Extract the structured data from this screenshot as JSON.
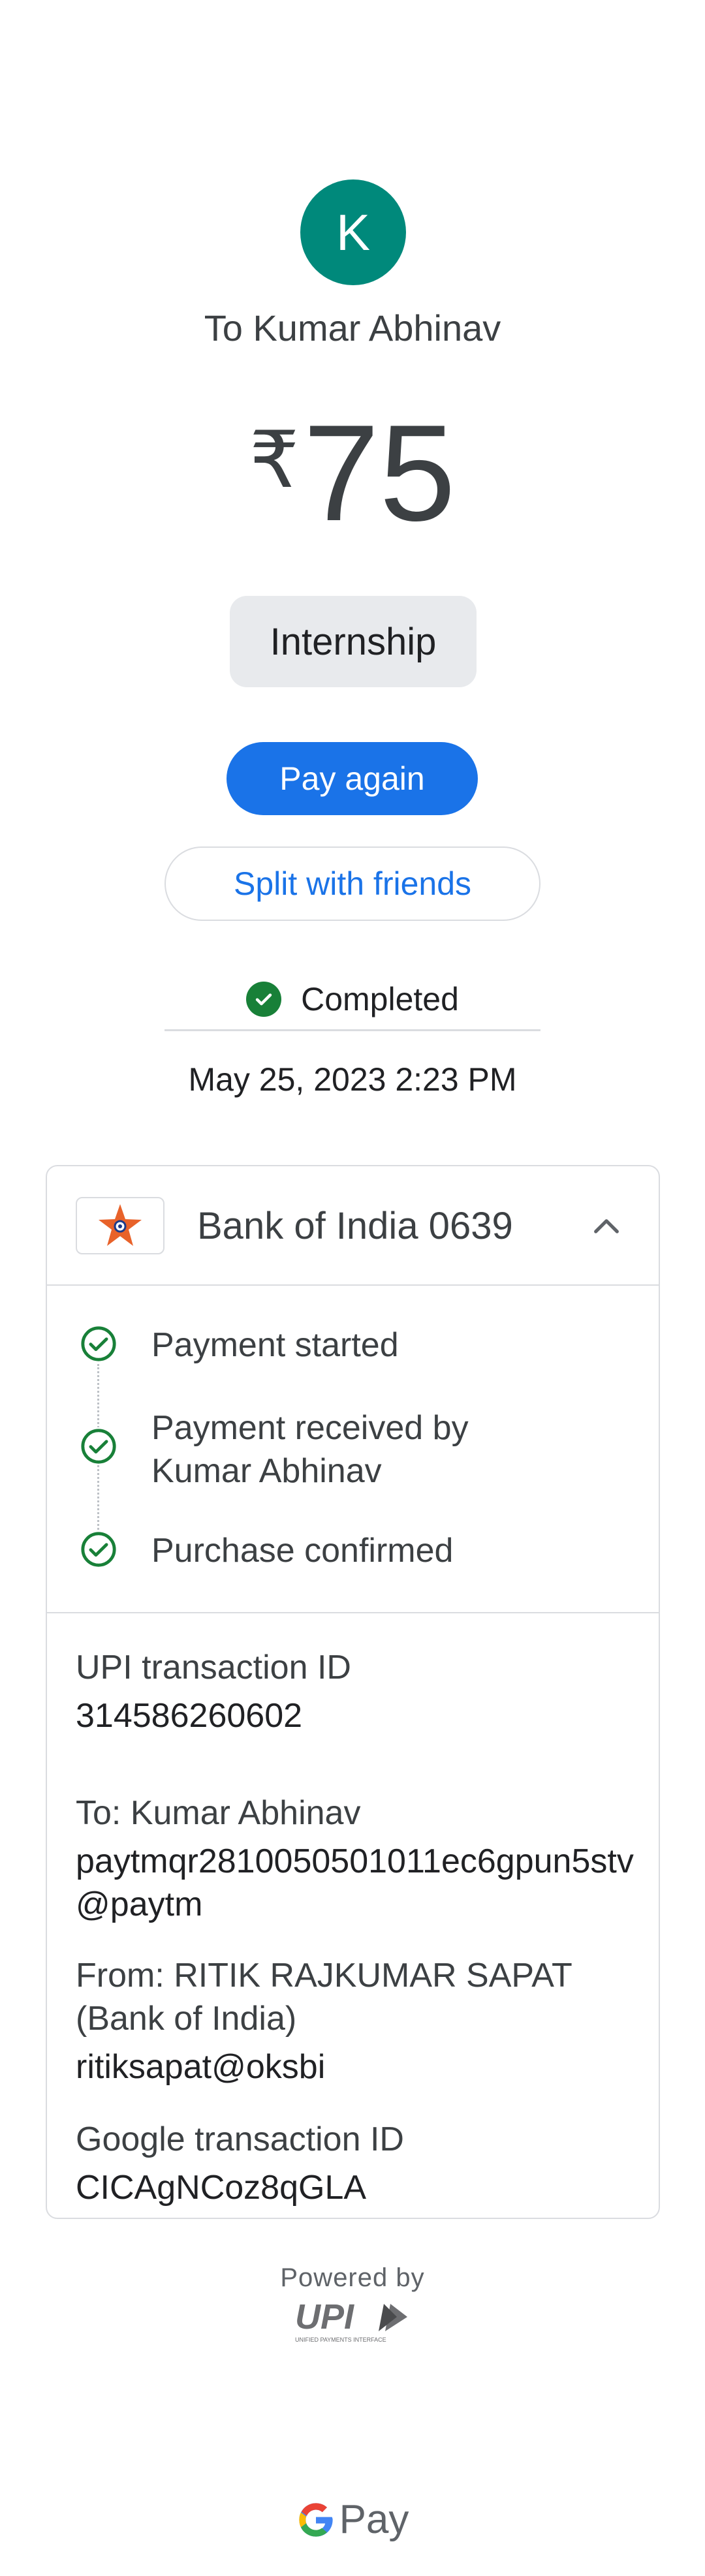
{
  "recipient": {
    "avatar_initial": "K",
    "to_label": "To Kumar Abhinav"
  },
  "payment": {
    "currency_symbol": "₹",
    "amount": "75",
    "note": "Internship",
    "status": "Completed",
    "datetime": "May 25, 2023 2:23 PM"
  },
  "actions": {
    "pay_again": "Pay again",
    "split": "Split with friends"
  },
  "bank": {
    "name": "Bank of India 0639"
  },
  "timeline": [
    {
      "label": "Payment started"
    },
    {
      "label": "Payment received by Kumar Abhinav"
    },
    {
      "label": "Purchase confirmed"
    }
  ],
  "details": {
    "upi_id_label": "UPI transaction ID",
    "upi_id_value": "314586260602",
    "to_label": "To: Kumar Abhinav",
    "to_value": "paytmqr2810050501011ec6gpun5stv@paytm",
    "from_label": "From: RITIK RAJKUMAR SAPAT (Bank of India)",
    "from_value": "ritiksapat@oksbi",
    "google_id_label": "Google transaction ID",
    "google_id_value": "CICAgNCoz8qGLA"
  },
  "footer": {
    "powered_by": "Powered by",
    "upi_text": "UPI",
    "upi_subtext": "UNIFIED PAYMENTS INTERFACE",
    "gpay_text": "Pay"
  },
  "colors": {
    "accent": "#1a73e8",
    "avatar": "#00897b",
    "success": "#188038"
  }
}
